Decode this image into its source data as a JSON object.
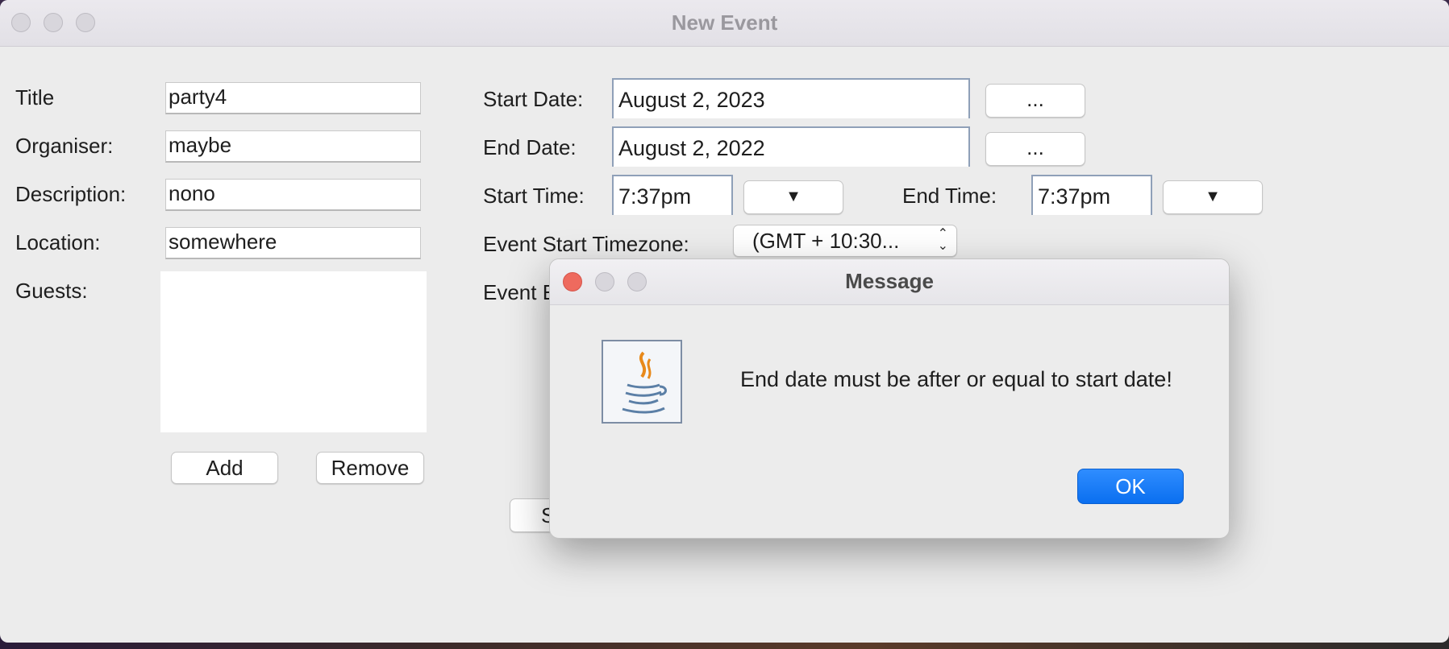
{
  "window": {
    "title": "New Event"
  },
  "form": {
    "title_label": "Title",
    "title_value": "party4",
    "organiser_label": "Organiser:",
    "organiser_value": "maybe",
    "description_label": "Description:",
    "description_value": "nono",
    "location_label": "Location:",
    "location_value": "somewhere",
    "guests_label": "Guests:",
    "add_label": "Add",
    "remove_label": "Remove",
    "start_date_label": "Start Date:",
    "start_date_value": "August 2, 2023",
    "end_date_label": "End Date:",
    "end_date_value": "August 2, 2022",
    "picker_label": "...",
    "start_time_label": "Start Time:",
    "start_time_value": "7:37pm",
    "end_time_label": "End Time:",
    "end_time_value": "7:37pm",
    "dropdown_arrow": "▼",
    "start_tz_label": "Event Start Timezone:",
    "start_tz_value": "(GMT + 10:30...",
    "end_tz_label_partial": "Event E",
    "hidden_button_partial": "S"
  },
  "dialog": {
    "title": "Message",
    "message": "End date must be after or equal to start date!",
    "ok_label": "OK",
    "icon": "java-icon"
  }
}
